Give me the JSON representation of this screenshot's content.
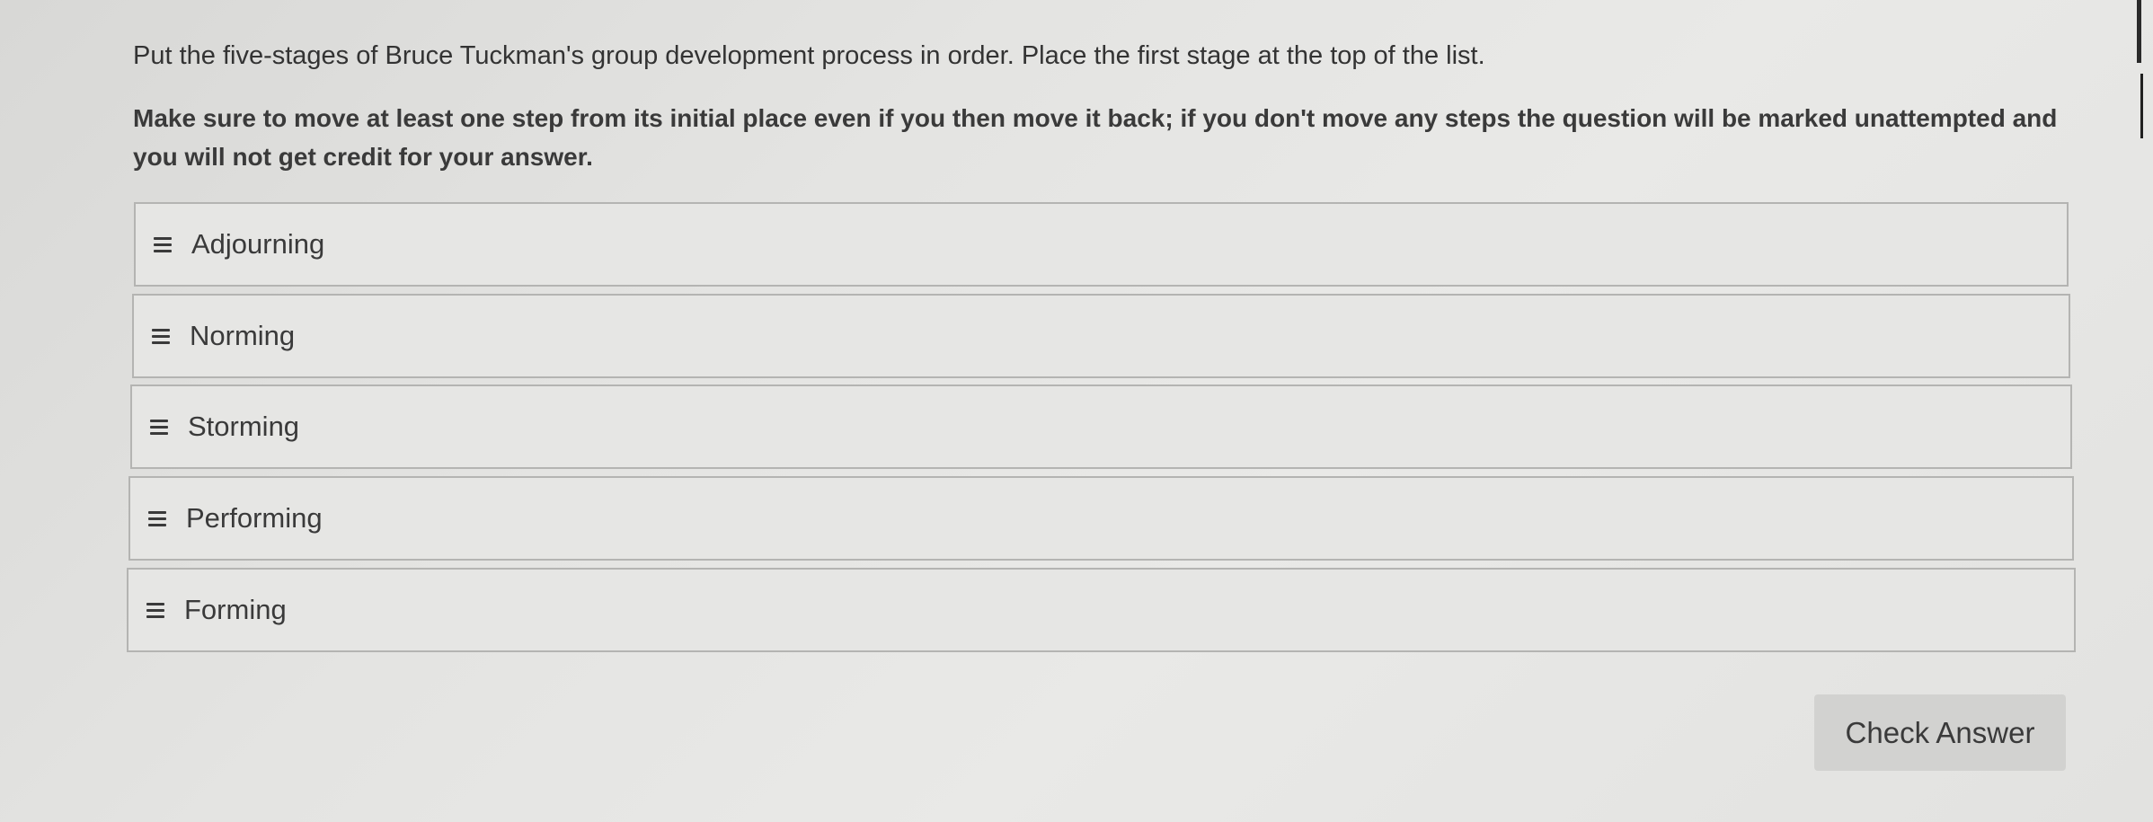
{
  "question": {
    "prompt": "Put the five-stages of Bruce Tuckman's group development process in order. Place the first stage at the top of the list.",
    "instruction": "Make sure to move at least one step from its initial place even if you then move it back; if you don't move any steps the question will be marked unattempted and you will not get credit for your answer."
  },
  "list": {
    "items": [
      {
        "label": "Adjourning",
        "icon": "drag-handle-icon"
      },
      {
        "label": "Norming",
        "icon": "drag-handle-icon"
      },
      {
        "label": "Storming",
        "icon": "drag-handle-icon"
      },
      {
        "label": "Performing",
        "icon": "drag-handle-icon"
      },
      {
        "label": "Forming",
        "icon": "drag-handle-icon"
      }
    ]
  },
  "actions": {
    "check_label": "Check Answer"
  },
  "colors": {
    "item_background": "#e6e6e4",
    "item_border": "#b4b4b2",
    "button_background": "#d2d2d0",
    "text": "#3a3a3a"
  }
}
